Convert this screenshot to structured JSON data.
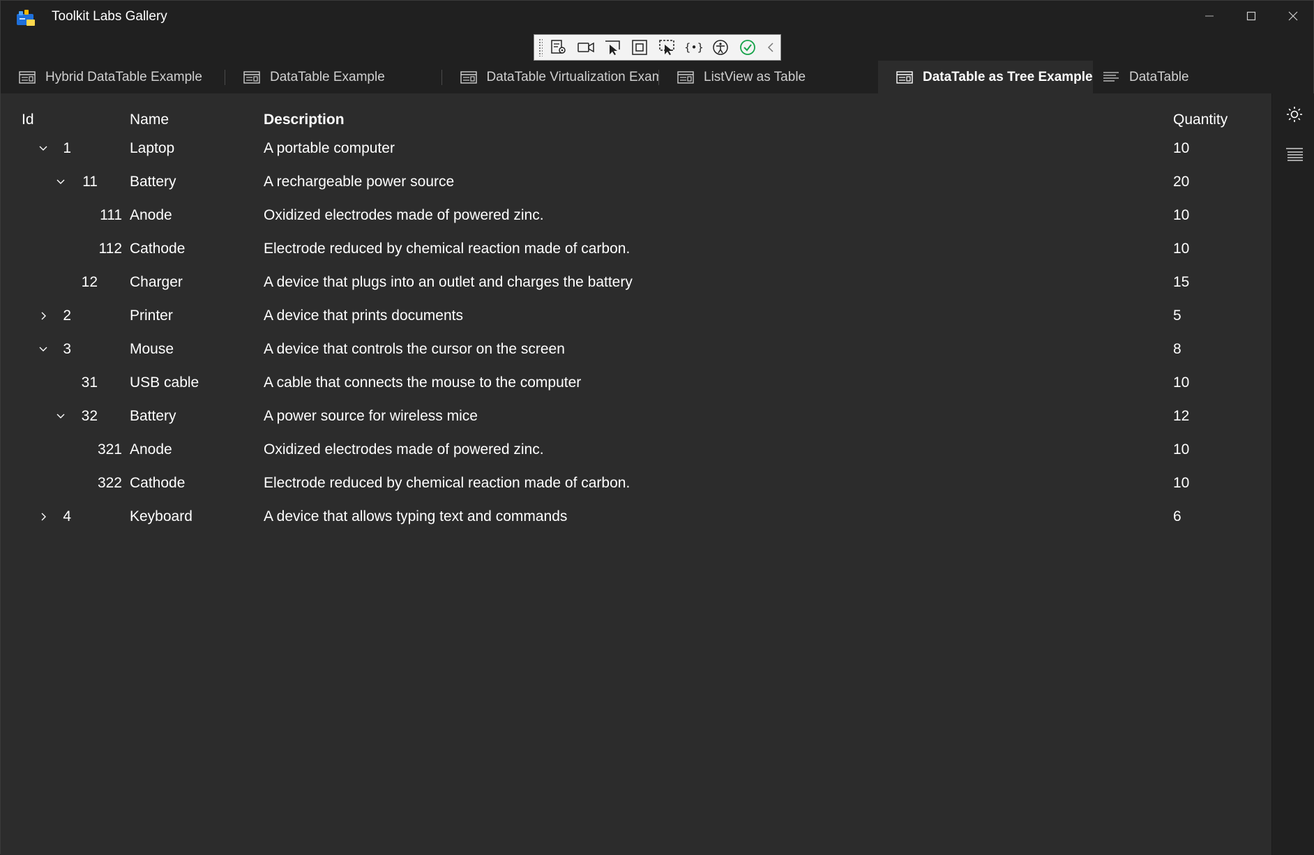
{
  "window": {
    "title": "Toolkit Labs Gallery"
  },
  "tabs": [
    {
      "label": "Hybrid DataTable Example",
      "active": false
    },
    {
      "label": "DataTable Example",
      "active": false
    },
    {
      "label": "DataTable Virtualization Example",
      "active": false
    },
    {
      "label": "ListView as Table",
      "active": false
    },
    {
      "label": "DataTable as Tree Example",
      "active": true
    },
    {
      "label": "DataTable",
      "active": false
    }
  ],
  "table": {
    "headers": {
      "id": "Id",
      "name": "Name",
      "description": "Description",
      "quantity": "Quantity"
    },
    "rows": [
      {
        "id": "1",
        "name": "Laptop",
        "description": "A portable computer",
        "quantity": "10",
        "level": 0,
        "expander": "expanded"
      },
      {
        "id": "11",
        "name": "Battery",
        "description": "A rechargeable power source",
        "quantity": "20",
        "level": 1,
        "expander": "expanded"
      },
      {
        "id": "111",
        "name": "Anode",
        "description": "Oxidized electrodes made of powered zinc.",
        "quantity": "10",
        "level": 2,
        "expander": "none"
      },
      {
        "id": "112",
        "name": "Cathode",
        "description": "Electrode reduced by chemical reaction made of carbon.",
        "quantity": "10",
        "level": 2,
        "expander": "none"
      },
      {
        "id": "12",
        "name": "Charger",
        "description": "A device that plugs into an outlet and charges the battery",
        "quantity": "15",
        "level": 1,
        "expander": "none"
      },
      {
        "id": "2",
        "name": "Printer",
        "description": "A device that prints documents",
        "quantity": "5",
        "level": 0,
        "expander": "collapsed"
      },
      {
        "id": "3",
        "name": "Mouse",
        "description": "A device that controls the cursor on the screen",
        "quantity": "8",
        "level": 0,
        "expander": "expanded"
      },
      {
        "id": "31",
        "name": "USB cable",
        "description": "A cable that connects the mouse to the computer",
        "quantity": "10",
        "level": 1,
        "expander": "none"
      },
      {
        "id": "32",
        "name": "Battery",
        "description": "A power source for wireless mice",
        "quantity": "12",
        "level": 1,
        "expander": "expanded"
      },
      {
        "id": "321",
        "name": "Anode",
        "description": "Oxidized electrodes made of powered zinc.",
        "quantity": "10",
        "level": 2,
        "expander": "none"
      },
      {
        "id": "322",
        "name": "Cathode",
        "description": "Electrode reduced by chemical reaction made of carbon.",
        "quantity": "10",
        "level": 2,
        "expander": "none"
      },
      {
        "id": "4",
        "name": "Keyboard",
        "description": "A device that allows typing text and commands",
        "quantity": "6",
        "level": 0,
        "expander": "collapsed"
      }
    ]
  },
  "icons": {
    "titlebar": [
      "app-icon",
      "minimize-icon",
      "maximize-icon",
      "close-icon"
    ],
    "debug_toolbar": [
      "live-visual-tree-icon",
      "record-icon",
      "select-element-icon",
      "display-layout-adorners-icon",
      "track-focus-icon",
      "binding-failures-icon",
      "accessibility-icon",
      "accessibility-check-icon",
      "collapse-toolbar-icon"
    ],
    "right_rail": [
      "theme-toggle-icon",
      "list-view-icon"
    ],
    "tab": "table-icon",
    "last_tab": "text-lines-icon"
  },
  "colors": {
    "background": "#202020",
    "content": "#2c2c2c",
    "text": "#ffffff",
    "check_green": "#16a34a"
  }
}
